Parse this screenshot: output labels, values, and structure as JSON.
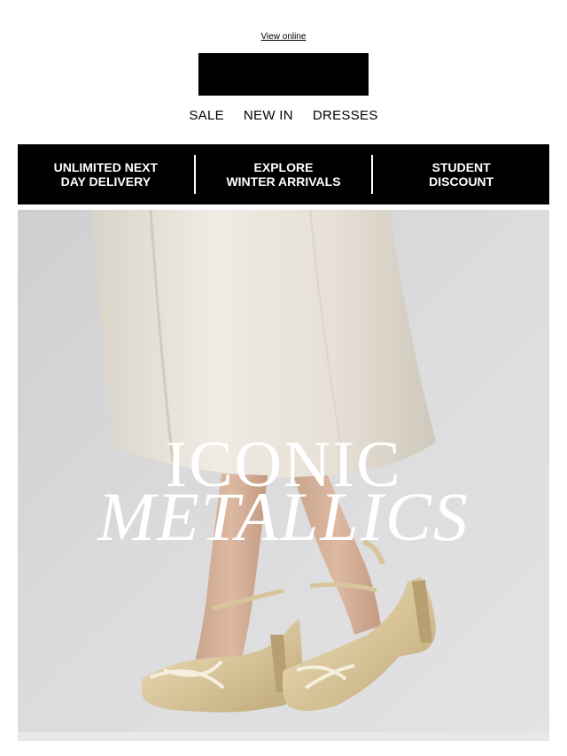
{
  "header": {
    "view_online": "View online"
  },
  "nav": {
    "items": [
      "SALE",
      "NEW IN",
      "DRESSES"
    ]
  },
  "banner": {
    "items": [
      {
        "line1": "UNLIMITED NEXT",
        "line2": "DAY DELIVERY"
      },
      {
        "line1": "EXPLORE",
        "line2": "WINTER ARRIVALS"
      },
      {
        "line1": "STUDENT",
        "line2": "DISCOUNT"
      }
    ]
  },
  "hero": {
    "title_line1": "ICONIC",
    "title_line2": "METALLICS"
  },
  "colors": {
    "banner_bg": "#000000",
    "banner_text": "#ffffff",
    "hero_bg": "#d6d6d8"
  }
}
